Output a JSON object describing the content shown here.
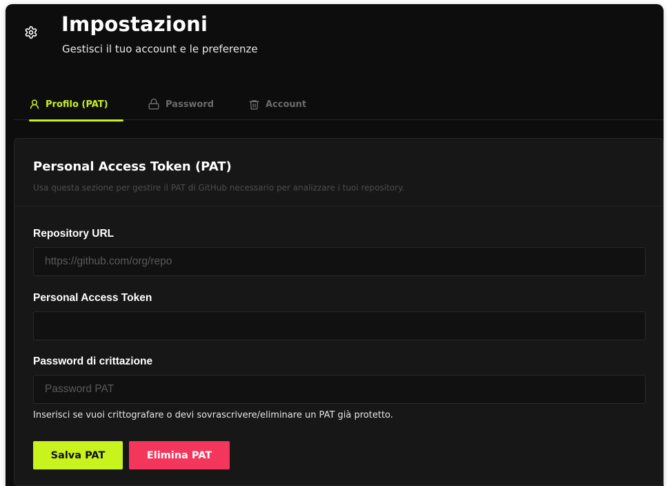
{
  "header": {
    "title": "Impostazioni",
    "subtitle": "Gestisci il tuo account e le preferenze"
  },
  "tabs": [
    {
      "label": "Profilo (PAT)",
      "icon": "user-icon",
      "active": true
    },
    {
      "label": "Password",
      "icon": "lock-icon",
      "active": false
    },
    {
      "label": "Account",
      "icon": "trash-icon",
      "active": false
    }
  ],
  "card": {
    "title": "Personal Access Token (PAT)",
    "description": "Usa questa sezione per gestire il PAT di GitHub necessario per analizzare i tuoi repository.",
    "fields": {
      "repo": {
        "label": "Repository URL",
        "value": "",
        "placeholder": "https://github.com/org/repo"
      },
      "token": {
        "label": "Personal Access Token",
        "value": "",
        "placeholder": ""
      },
      "password": {
        "label": "Password di crittazione",
        "value": "",
        "placeholder": "Password PAT"
      }
    },
    "hint": "Inserisci se vuoi crittografare o devi sovrascrivere/eliminare un PAT già protetto.",
    "buttons": {
      "save": "Salva PAT",
      "delete": "Elimina PAT"
    }
  },
  "colors": {
    "background": "#0d0d0d",
    "card": "#171717",
    "accent": "#c8f31d",
    "danger": "#f5365c",
    "muted": "#6b6b6b"
  }
}
